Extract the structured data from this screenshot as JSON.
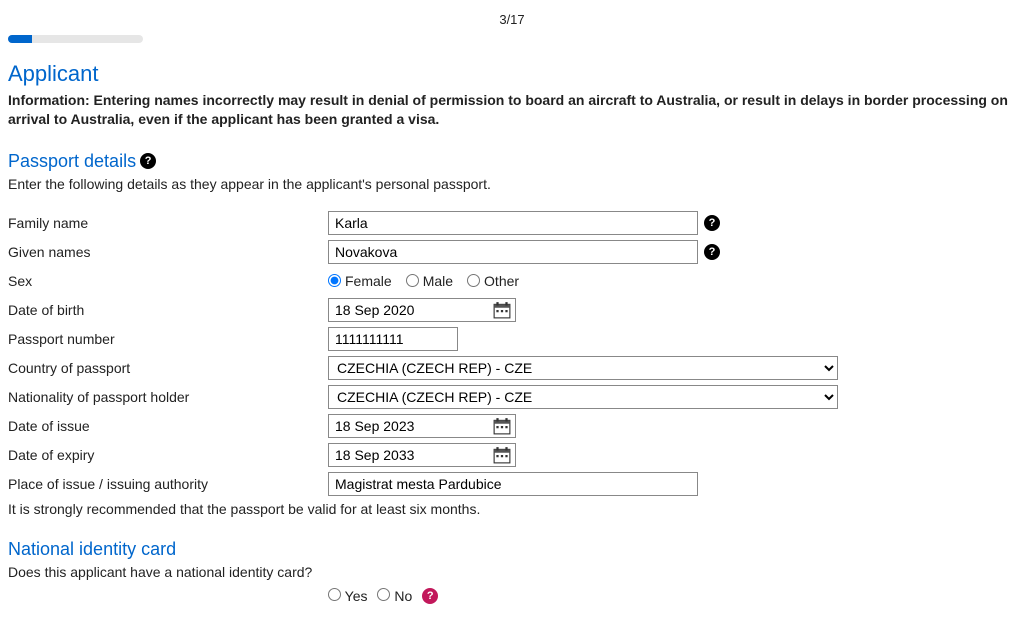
{
  "progress": {
    "page": "3/17"
  },
  "applicant": {
    "heading": "Applicant",
    "info_prefix": "Information: ",
    "info_text": "Entering names incorrectly may result in denial of permission to board an aircraft to Australia, or result in delays in border processing on arrival to Australia, even if the applicant has been granted a visa."
  },
  "passport": {
    "heading": "Passport details",
    "intro": "Enter the following details as they appear in the applicant's personal passport.",
    "labels": {
      "family_name": "Family name",
      "given_names": "Given names",
      "sex": "Sex",
      "dob": "Date of birth",
      "passport_number": "Passport number",
      "country": "Country of passport",
      "nationality": "Nationality of passport holder",
      "issue": "Date of issue",
      "expiry": "Date of expiry",
      "place": "Place of issue / issuing authority"
    },
    "values": {
      "family_name": "Karla",
      "given_names": "Novakova",
      "dob": "18 Sep 2020",
      "passport_number": "1111111111",
      "country": "CZECHIA (CZECH REP) - CZE",
      "nationality": "CZECHIA (CZECH REP) - CZE",
      "issue": "18 Sep 2023",
      "expiry": "18 Sep 2033",
      "place": "Magistrat mesta Pardubice"
    },
    "sex_options": {
      "female": "Female",
      "male": "Male",
      "other": "Other"
    },
    "sex_selected": "female",
    "recommend": "It is strongly recommended that the passport be valid for at least six months."
  },
  "nic": {
    "heading": "National identity card",
    "question": "Does this applicant have a national identity card?",
    "yes": "Yes",
    "no": "No"
  }
}
